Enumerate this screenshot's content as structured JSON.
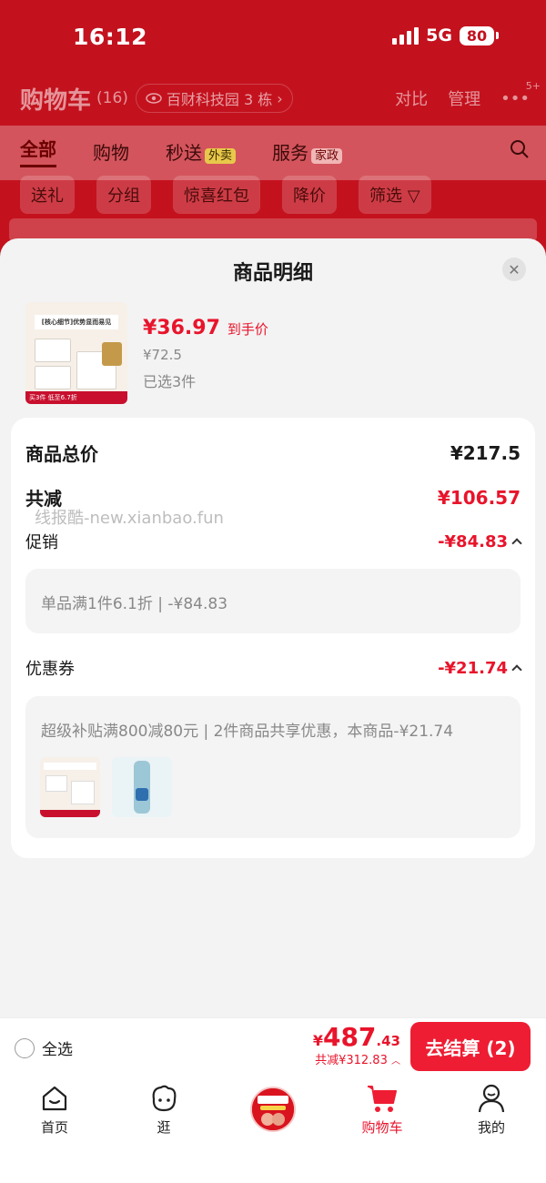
{
  "status_bar": {
    "time": "16:12",
    "network": "5G",
    "battery": "80"
  },
  "cart_header": {
    "title": "购物车",
    "count": "(16)",
    "location": "百财科技园 3 栋",
    "compare": "对比",
    "manage": "管理",
    "more_badge": "5+"
  },
  "top_tabs": [
    {
      "label": "全部"
    },
    {
      "label": "购物"
    },
    {
      "label": "秒送",
      "badge": "外卖"
    },
    {
      "label": "服务",
      "badge": "家政"
    }
  ],
  "filter_chips": [
    "送礼",
    "分组",
    "惊喜红包",
    "降价",
    "筛选"
  ],
  "sheet": {
    "title": "商品明细",
    "product": {
      "thumb_text": "[核心细节]优势显而易见",
      "thumb_bar": "买3件 低至6.7折",
      "price": "¥36.97",
      "price_tag": "到手价",
      "original_price": "¥72.5",
      "selected": "已选3件"
    },
    "summary": {
      "total_label": "商品总价",
      "total_value": "¥217.5",
      "discount_label": "共减",
      "discount_value": "¥106.57",
      "watermark": "线报酷-new.xianbao.fun",
      "promo_label": "促销",
      "promo_value": "-¥84.83",
      "promo_detail": "单品满1件6.1折 | -¥84.83",
      "coupon_label": "优惠券",
      "coupon_value": "-¥21.74",
      "coupon_detail": "超级补贴满800减80元 | 2件商品共享优惠，本商品-¥21.74"
    }
  },
  "checkout": {
    "select_all": "全选",
    "total_yen": "¥",
    "total_int": "487",
    "total_dec": ".43",
    "total_sub": "共减¥312.83",
    "button": "去结算 (2)"
  },
  "tabbar": [
    {
      "label": "首页"
    },
    {
      "label": "逛"
    },
    {
      "label": ""
    },
    {
      "label": "购物车"
    },
    {
      "label": "我的"
    }
  ],
  "colors": {
    "brand_red": "#e8142b",
    "header_red": "#c3121e"
  }
}
